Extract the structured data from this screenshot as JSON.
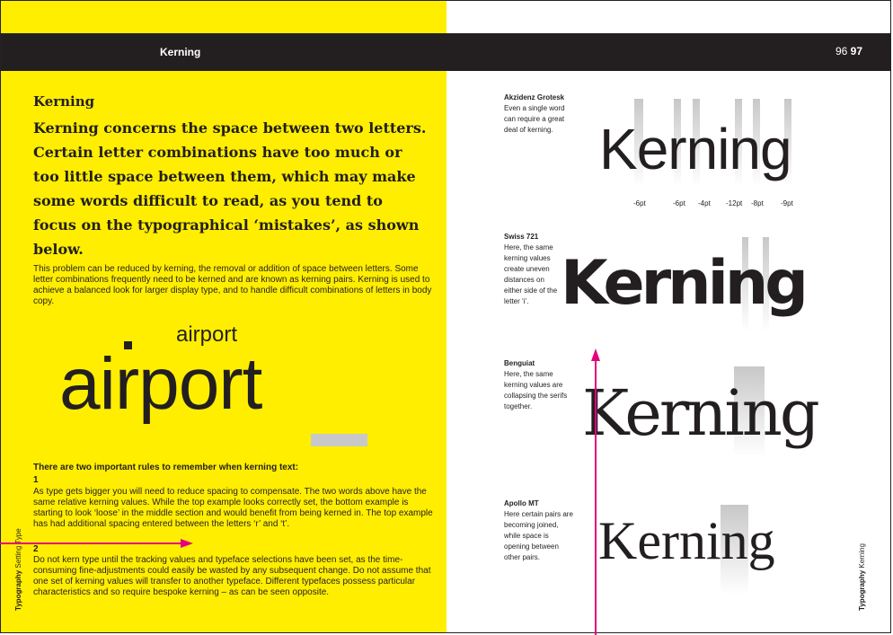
{
  "header": {
    "title": "Kerning",
    "page_left": "96",
    "page_right": "97"
  },
  "left": {
    "heading": "Kerning",
    "lede": "Kerning concerns the space between two letters. Certain letter combinations have too much or too little space between them, which may make some words difficult to read, as you tend to focus on the typographical ‘mistakes’, as shown below.",
    "body": "This problem can be reduced by kerning, the removal or addition of space between letters. Some letter combinations frequently need to be kerned and are known as kerning pairs. Kerning is used to achieve a balanced look for larger display type, and to handle difficult combinations of letters in body copy.",
    "sample_small": "airport",
    "sample_large": "airport",
    "rules_heading": "There are two important rules to remember when kerning text:",
    "rule1_num": "1",
    "rule1": "As type gets bigger you will need to reduce spacing to compensate. The two words above have the same relative kerning values. While the top example looks correctly set, the bottom example is starting to look ‘loose’ in the middle section and would benefit from being kerned in. The top example has had additional spacing entered between the letters ‘r’ and ‘t’.",
    "rule2_num": "2",
    "rule2": "Do not kern type until the tracking values and typeface selections have been set, as the time-consuming fine-adjustments could easily be wasted by any subsequent change. Do not assume that one set of kerning values will transfer to another typeface. Different typefaces possess particular characteristics and so require bespoke kerning –  as can be seen opposite.",
    "side_label_bold": "Typography",
    "side_label": "Setting Type"
  },
  "right": {
    "examples": [
      {
        "font": "Akzidenz Grotesk",
        "caption": "Even a single word can require a great deal of kerning.",
        "word": "Kerning"
      },
      {
        "font": "Swiss 721",
        "caption": "Here, the same kerning values create uneven distances on either side of the letter ‘i’.",
        "word": "Kerning"
      },
      {
        "font": "Benguiat",
        "caption": "Here, the same kerning values are collapsing the serifs together.",
        "word": "Kerning"
      },
      {
        "font": "Apollo MT",
        "caption": "Here certain pairs are becoming joined, while space is opening between other pairs.",
        "word": "Kerning"
      }
    ],
    "kern_values": [
      "-6pt",
      "-6pt",
      "-4pt",
      "-12pt",
      "-8pt",
      "-9pt"
    ],
    "side_label_bold": "Typography",
    "side_label": "Kerning"
  },
  "colors": {
    "spread_left": "#ffee00",
    "bar": "#231f20",
    "arrow": "#e5007e",
    "highlight": "#c8c8c8"
  },
  "icons": [
    "arrow-right-icon",
    "arrow-up-icon"
  ]
}
